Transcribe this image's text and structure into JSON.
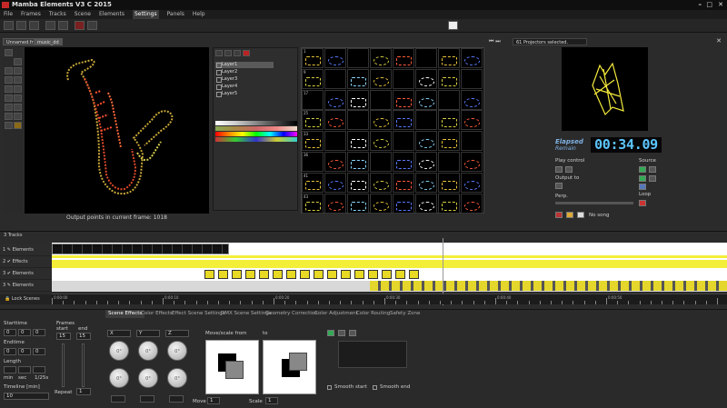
{
  "window": {
    "title": "Mamba Elements V3 C 2015"
  },
  "menu": [
    "File",
    "Frames",
    "Tracks",
    "Scene",
    "Elements",
    "Settings",
    "Panels",
    "Help"
  ],
  "menu_active_index": 5,
  "tabs": {
    "file_tab": "Unnamed.fra",
    "active_tab": "music_dd"
  },
  "canvas": {
    "status": "Output points in current frame: 1018"
  },
  "layers": [
    "Layer1",
    "Layer2",
    "Layer3",
    "Layer4",
    "Layer5"
  ],
  "grid": {
    "row_numbers": [
      "1",
      "9",
      "17",
      "25",
      "33",
      "36",
      "41",
      "43",
      "49"
    ]
  },
  "projector": {
    "status": "61 Projectors selected."
  },
  "clock": {
    "label": "Elapsed",
    "label2": "Remain",
    "time": "00:34.09"
  },
  "controls": {
    "play_control": "Play control",
    "output_to": "Output to",
    "source": "Source",
    "perp": "Perp.",
    "loop": "Loop",
    "song": "No song"
  },
  "tracks": {
    "header": "3 Tracks",
    "rows": [
      {
        "num": "1",
        "name": "Elements"
      },
      {
        "num": "2",
        "name": "Effects"
      },
      {
        "num": "3",
        "name": "Elements"
      },
      {
        "num": "3",
        "name": "Elements"
      }
    ],
    "lock_label": "Lock Scenes"
  },
  "ruler": [
    "0:00:00",
    "0:00:10",
    "0:00:20",
    "0:00:30",
    "0:00:40",
    "0:00:50",
    "0:01:00",
    "0:01:10"
  ],
  "bottom": {
    "tabs": [
      "Scene Effects",
      "Color Effects",
      "Effect Scene Settings",
      "DMX Scene Settings",
      "Geometry Correction",
      "Color Adjustment",
      "Color Routing",
      "Safety Zone"
    ],
    "active_tab": 0,
    "starttime": "Starttime",
    "endtime": "Endtime",
    "length": "Length",
    "length_units": [
      "min",
      "sec",
      "1/25s"
    ],
    "timeline_label": "Timeline [min]",
    "timeline_value": "10",
    "frames_label": "Frames",
    "start_label": "start",
    "end_label": "end",
    "frames_start": "15",
    "frames_end": "15",
    "repeat": "Repeat",
    "repeat_value": "1",
    "axes": [
      "X",
      "Y",
      "Z"
    ],
    "knob_values": [
      "0°",
      "0°",
      "0°",
      "0°",
      "0°",
      "0°"
    ],
    "move_scale_from": "Move/scale from",
    "to": "to",
    "move_label": "Move",
    "scale_label": "Scale",
    "move_value": "1",
    "scale_value": "1",
    "smooth_start": "Smooth start",
    "smooth_end": "Smooth end",
    "zero_values": [
      "0",
      "0",
      "0",
      "0",
      "0",
      "0"
    ]
  }
}
